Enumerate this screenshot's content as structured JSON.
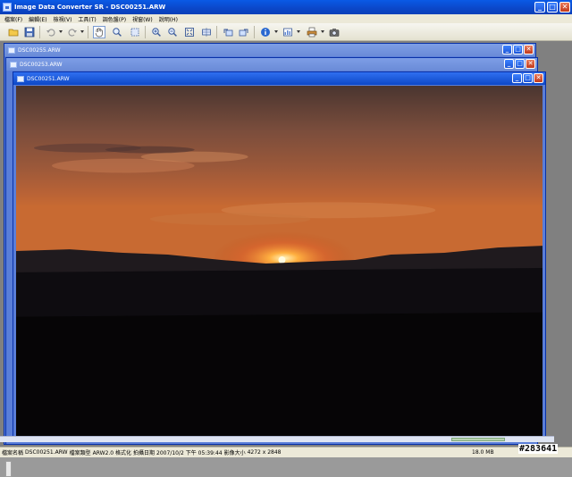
{
  "window": {
    "title": "Image Data Converter SR - DSC00251.ARW",
    "buttons": {
      "minimize": "_",
      "maximize": "□",
      "close": "✕"
    }
  },
  "menu": {
    "items": [
      {
        "label": "檔案(F)"
      },
      {
        "label": "編輯(E)"
      },
      {
        "label": "檢視(V)"
      },
      {
        "label": "工具(T)"
      },
      {
        "label": "調色盤(P)"
      },
      {
        "label": "視窗(W)"
      },
      {
        "label": "說明(H)"
      }
    ]
  },
  "toolbar": {
    "tools": [
      {
        "name": "open-folder-icon"
      },
      {
        "name": "save-icon"
      },
      {
        "name": "undo-icon"
      },
      {
        "name": "redo-icon"
      },
      {
        "name": "hand-tool-icon"
      },
      {
        "name": "magnifier-icon"
      },
      {
        "name": "select-tool-icon"
      },
      {
        "name": "zoom-in-icon"
      },
      {
        "name": "zoom-out-icon"
      },
      {
        "name": "fit-window-icon"
      },
      {
        "name": "actual-size-icon"
      },
      {
        "name": "rotate-left-icon"
      },
      {
        "name": "rotate-right-icon"
      },
      {
        "name": "info-icon"
      },
      {
        "name": "histogram-icon"
      },
      {
        "name": "print-icon"
      },
      {
        "name": "camera-icon"
      }
    ]
  },
  "documents": [
    {
      "title": "DSC00255.ARW",
      "active": false
    },
    {
      "title": "DSC00253.ARW",
      "active": false
    },
    {
      "title": "DSC00251.ARW",
      "active": true
    }
  ],
  "status": {
    "file_name_label": "檔案名稱",
    "file_name": "DSC00251.ARW",
    "file_type_label": "檔案類型",
    "file_type": "ARW2.0 格式化",
    "date_label": "拍攝日期",
    "date": "2007/10/2 下午 05:39:44",
    "size_label": "影像大小",
    "size": "4272 x 2848",
    "file_size": "18.0 MB"
  },
  "watermark": "#283641",
  "colors": {
    "title_blue": "#0b47c8",
    "window_bg": "#ece9d8",
    "close_red": "#c2391b"
  }
}
